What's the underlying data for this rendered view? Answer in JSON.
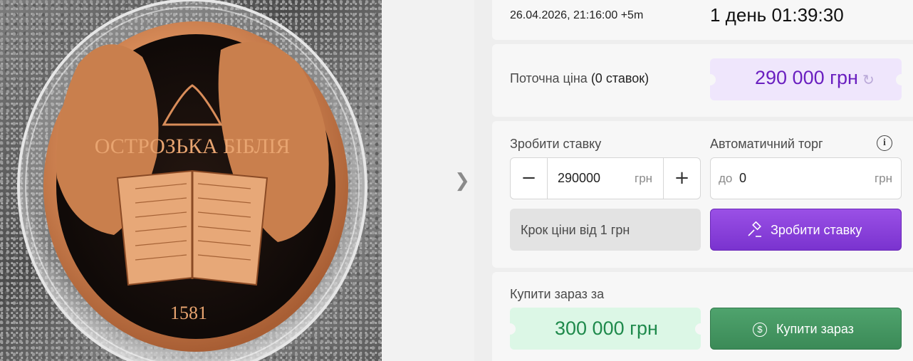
{
  "gallery": {
    "coin_inscription": "ОСТРОЗЬКА БІБЛІЯ",
    "coin_year": "1581",
    "next_icon": "chevron-right-icon"
  },
  "auction": {
    "end_datetime": "26.04.2026, 21:16:00 +5m",
    "countdown": "1 день 01:39:30"
  },
  "current_price": {
    "label_prefix": "Поточна ціна ",
    "bids_count": "(0 ставок)",
    "value": "290 000 грн",
    "refresh_icon": "refresh-icon"
  },
  "bid": {
    "label": "Зробити ставку",
    "minus": "−",
    "value": "290000",
    "currency": "грн",
    "plus": "+",
    "step_text": "Крок ціни від 1 грн",
    "button_label": "Зробити ставку",
    "button_icon": "gavel-icon"
  },
  "auto_bid": {
    "label": "Автоматичний торг",
    "info_icon": "info-icon",
    "prefix": "до",
    "value": "0",
    "currency": "грн"
  },
  "buy_now": {
    "label": "Купити зараз за",
    "value": "300 000 грн",
    "button_label": "Купити зараз",
    "button_icon": "dollar-coin-icon"
  },
  "colors": {
    "accent_purple": "#7a33cf",
    "price_purple": "#6a1fc0",
    "buy_green": "#3b8a57",
    "buy_value_green": "#1f8a4c"
  }
}
